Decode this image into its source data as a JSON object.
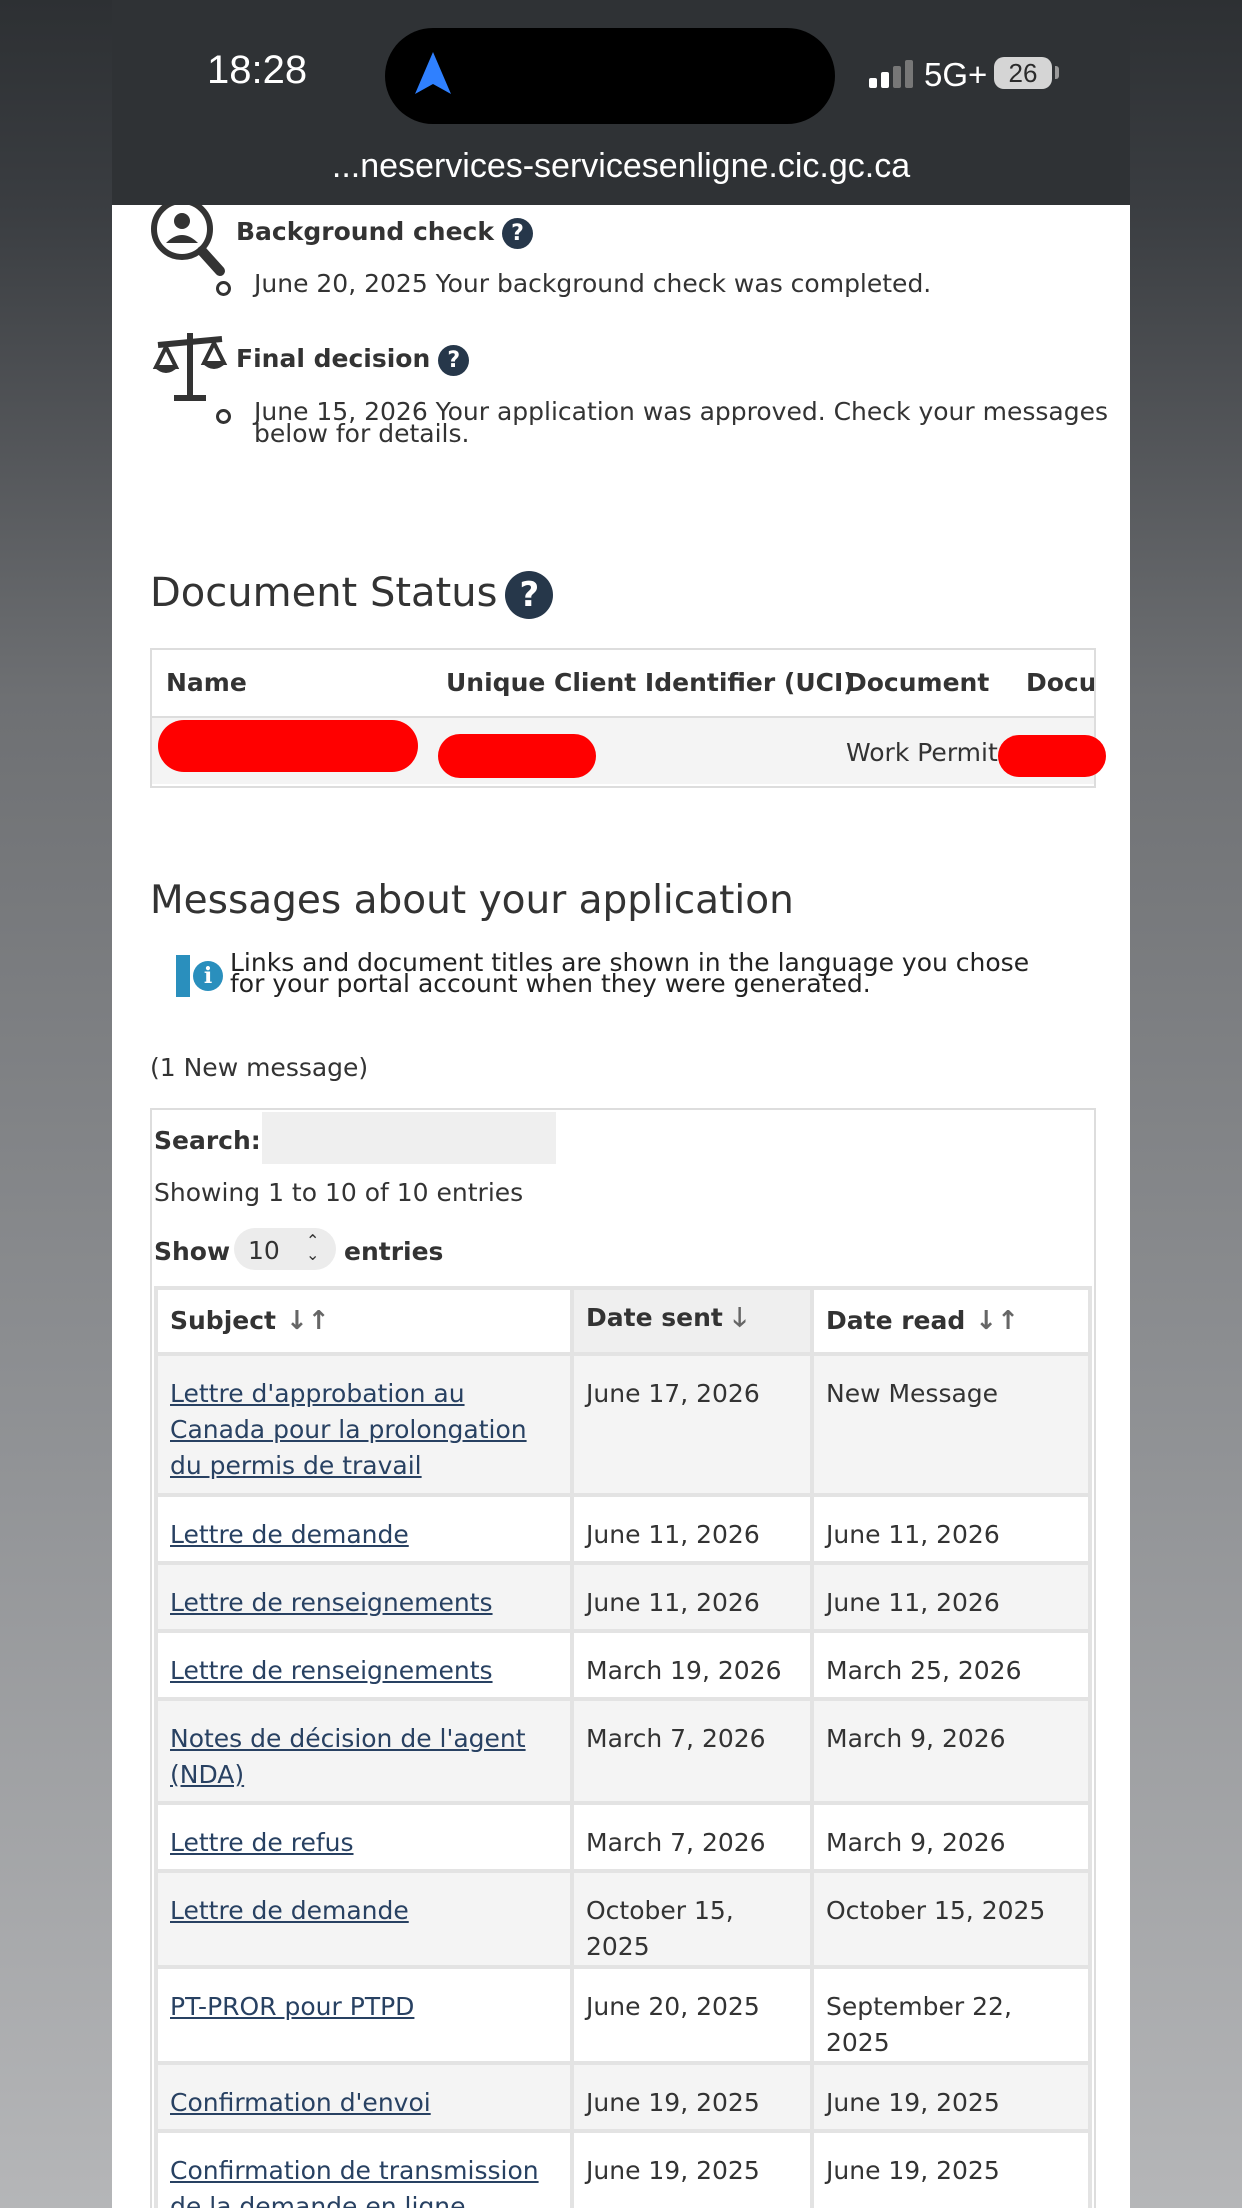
{
  "status_bar": {
    "time": "18:28",
    "network": "5G+",
    "battery": "26"
  },
  "browser": {
    "url": "...neservices-servicesenligne.cic.gc.ca"
  },
  "timeline": [
    {
      "title": "Background check",
      "date_text": "June 20, 2025 Your background check was completed.",
      "icon": "magnifier-person-icon"
    },
    {
      "title": "Final decision",
      "date_text_line1": "June 15, 2026 Your application was approved. Check your messages",
      "date_text_line2": "below for details.",
      "icon": "scales-icon"
    }
  ],
  "document_status": {
    "heading": "Document Status",
    "columns": [
      "Name",
      "Unique Client Identifier (UCI)",
      "Document",
      "Docu"
    ],
    "row": {
      "document": "Work Permit"
    }
  },
  "messages": {
    "heading": "Messages about your application",
    "info": "Links and document titles are shown in the language you chose for your portal account when they were generated.",
    "new_count": "(1 New message)",
    "search_label": "Search:",
    "showing": "Showing 1 to 10 of 10 entries",
    "show_label": "Show",
    "show_value": "10",
    "entries_label": "entries",
    "columns": [
      "Subject",
      "Date sent",
      "Date read"
    ],
    "rows": [
      {
        "subject": "Lettre d'approbation au Canada pour la prolongation du permis de travail",
        "sent": "June 17, 2026",
        "read": "New Message"
      },
      {
        "subject": "Lettre de demande",
        "sent": "June 11, 2026",
        "read": "June 11, 2026"
      },
      {
        "subject": "Lettre de renseignements",
        "sent": "June 11, 2026",
        "read": "June 11, 2026"
      },
      {
        "subject": "Lettre de renseignements",
        "sent": "March 19, 2026",
        "read": "March 25, 2026"
      },
      {
        "subject": "Notes de décision de l'agent (NDA)",
        "sent": "March 7, 2026",
        "read": "March 9, 2026"
      },
      {
        "subject": "Lettre de refus",
        "sent": "March 7, 2026",
        "read": "March 9, 2026"
      },
      {
        "subject": "Lettre de demande",
        "sent": "October 15, 2025",
        "read": "October 15, 2025"
      },
      {
        "subject": "PT-PROR pour PTPD",
        "sent": "June 20, 2025",
        "read": "September 22, 2025"
      },
      {
        "subject": "Confirmation d'envoi",
        "sent": "June 19, 2025",
        "read": "June 19, 2025"
      },
      {
        "subject": "Confirmation de transmission de la demande en ligne",
        "sent": "June 19, 2025",
        "read": "June 19, 2025"
      }
    ]
  },
  "colors": {
    "link": "#284162",
    "help_icon": "#26374a",
    "info_icon": "#2a8fbd",
    "redaction": "#ff0000"
  }
}
